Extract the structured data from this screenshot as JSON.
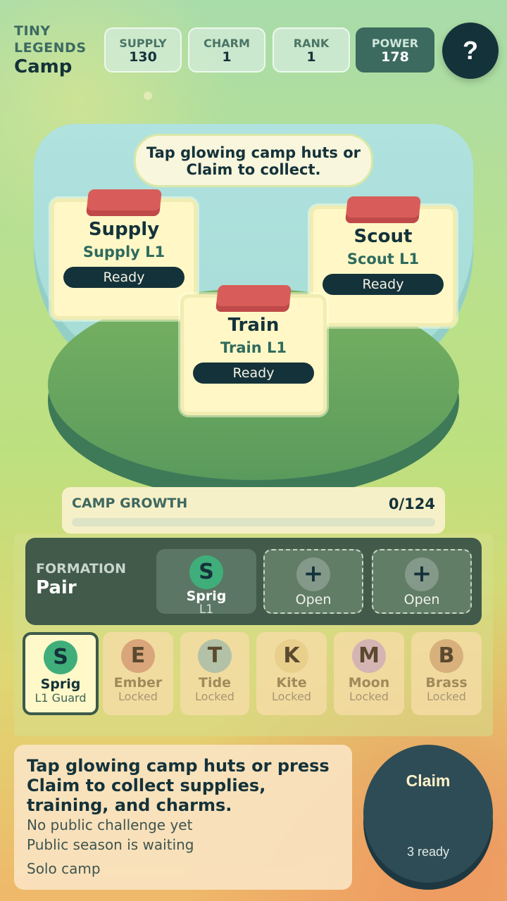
{
  "header": {
    "brand_line1": "TINY",
    "brand_line2": "LEGENDS",
    "title": "Camp",
    "stats": [
      {
        "label": "SUPPLY",
        "value": "130"
      },
      {
        "label": "CHARM",
        "value": "1"
      },
      {
        "label": "RANK",
        "value": "1"
      },
      {
        "label": "POWER",
        "value": "178"
      }
    ],
    "help_label": "?"
  },
  "camp": {
    "tip": "Tap glowing camp huts or Claim to collect.",
    "huts": [
      {
        "name": "Supply",
        "level": "Supply L1",
        "status": "Ready"
      },
      {
        "name": "Train",
        "level": "Train L1",
        "status": "Ready"
      },
      {
        "name": "Scout",
        "level": "Scout L1",
        "status": "Ready"
      }
    ]
  },
  "growth": {
    "label": "CAMP GROWTH",
    "value": "0/124",
    "progress_fraction": 0
  },
  "formation": {
    "label": "FORMATION",
    "name": "Pair",
    "slots": [
      {
        "initial": "S",
        "name": "Sprig",
        "level": "L1"
      },
      {
        "initial": "+",
        "name": "Open"
      },
      {
        "initial": "+",
        "name": "Open"
      }
    ]
  },
  "heroes": [
    {
      "initial": "S",
      "name": "Sprig",
      "status": "L1 Guard",
      "color": "#3fae7a"
    },
    {
      "initial": "E",
      "name": "Ember",
      "status": "Locked",
      "color": "#d9a57a"
    },
    {
      "initial": "T",
      "name": "Tide",
      "status": "Locked",
      "color": "#b3c2a6"
    },
    {
      "initial": "K",
      "name": "Kite",
      "status": "Locked",
      "color": "#e8cf8c"
    },
    {
      "initial": "M",
      "name": "Moon",
      "status": "Locked",
      "color": "#d5b4b4"
    },
    {
      "initial": "B",
      "name": "Brass",
      "status": "Locked",
      "color": "#d7b07c"
    }
  ],
  "info": {
    "main": "Tap glowing camp huts or press Claim to collect supplies, training, and charms.",
    "challenge": "No public challenge yet",
    "season": "Public season is waiting",
    "mode": "Solo camp"
  },
  "claim": {
    "label": "Claim",
    "count": "3 ready"
  }
}
